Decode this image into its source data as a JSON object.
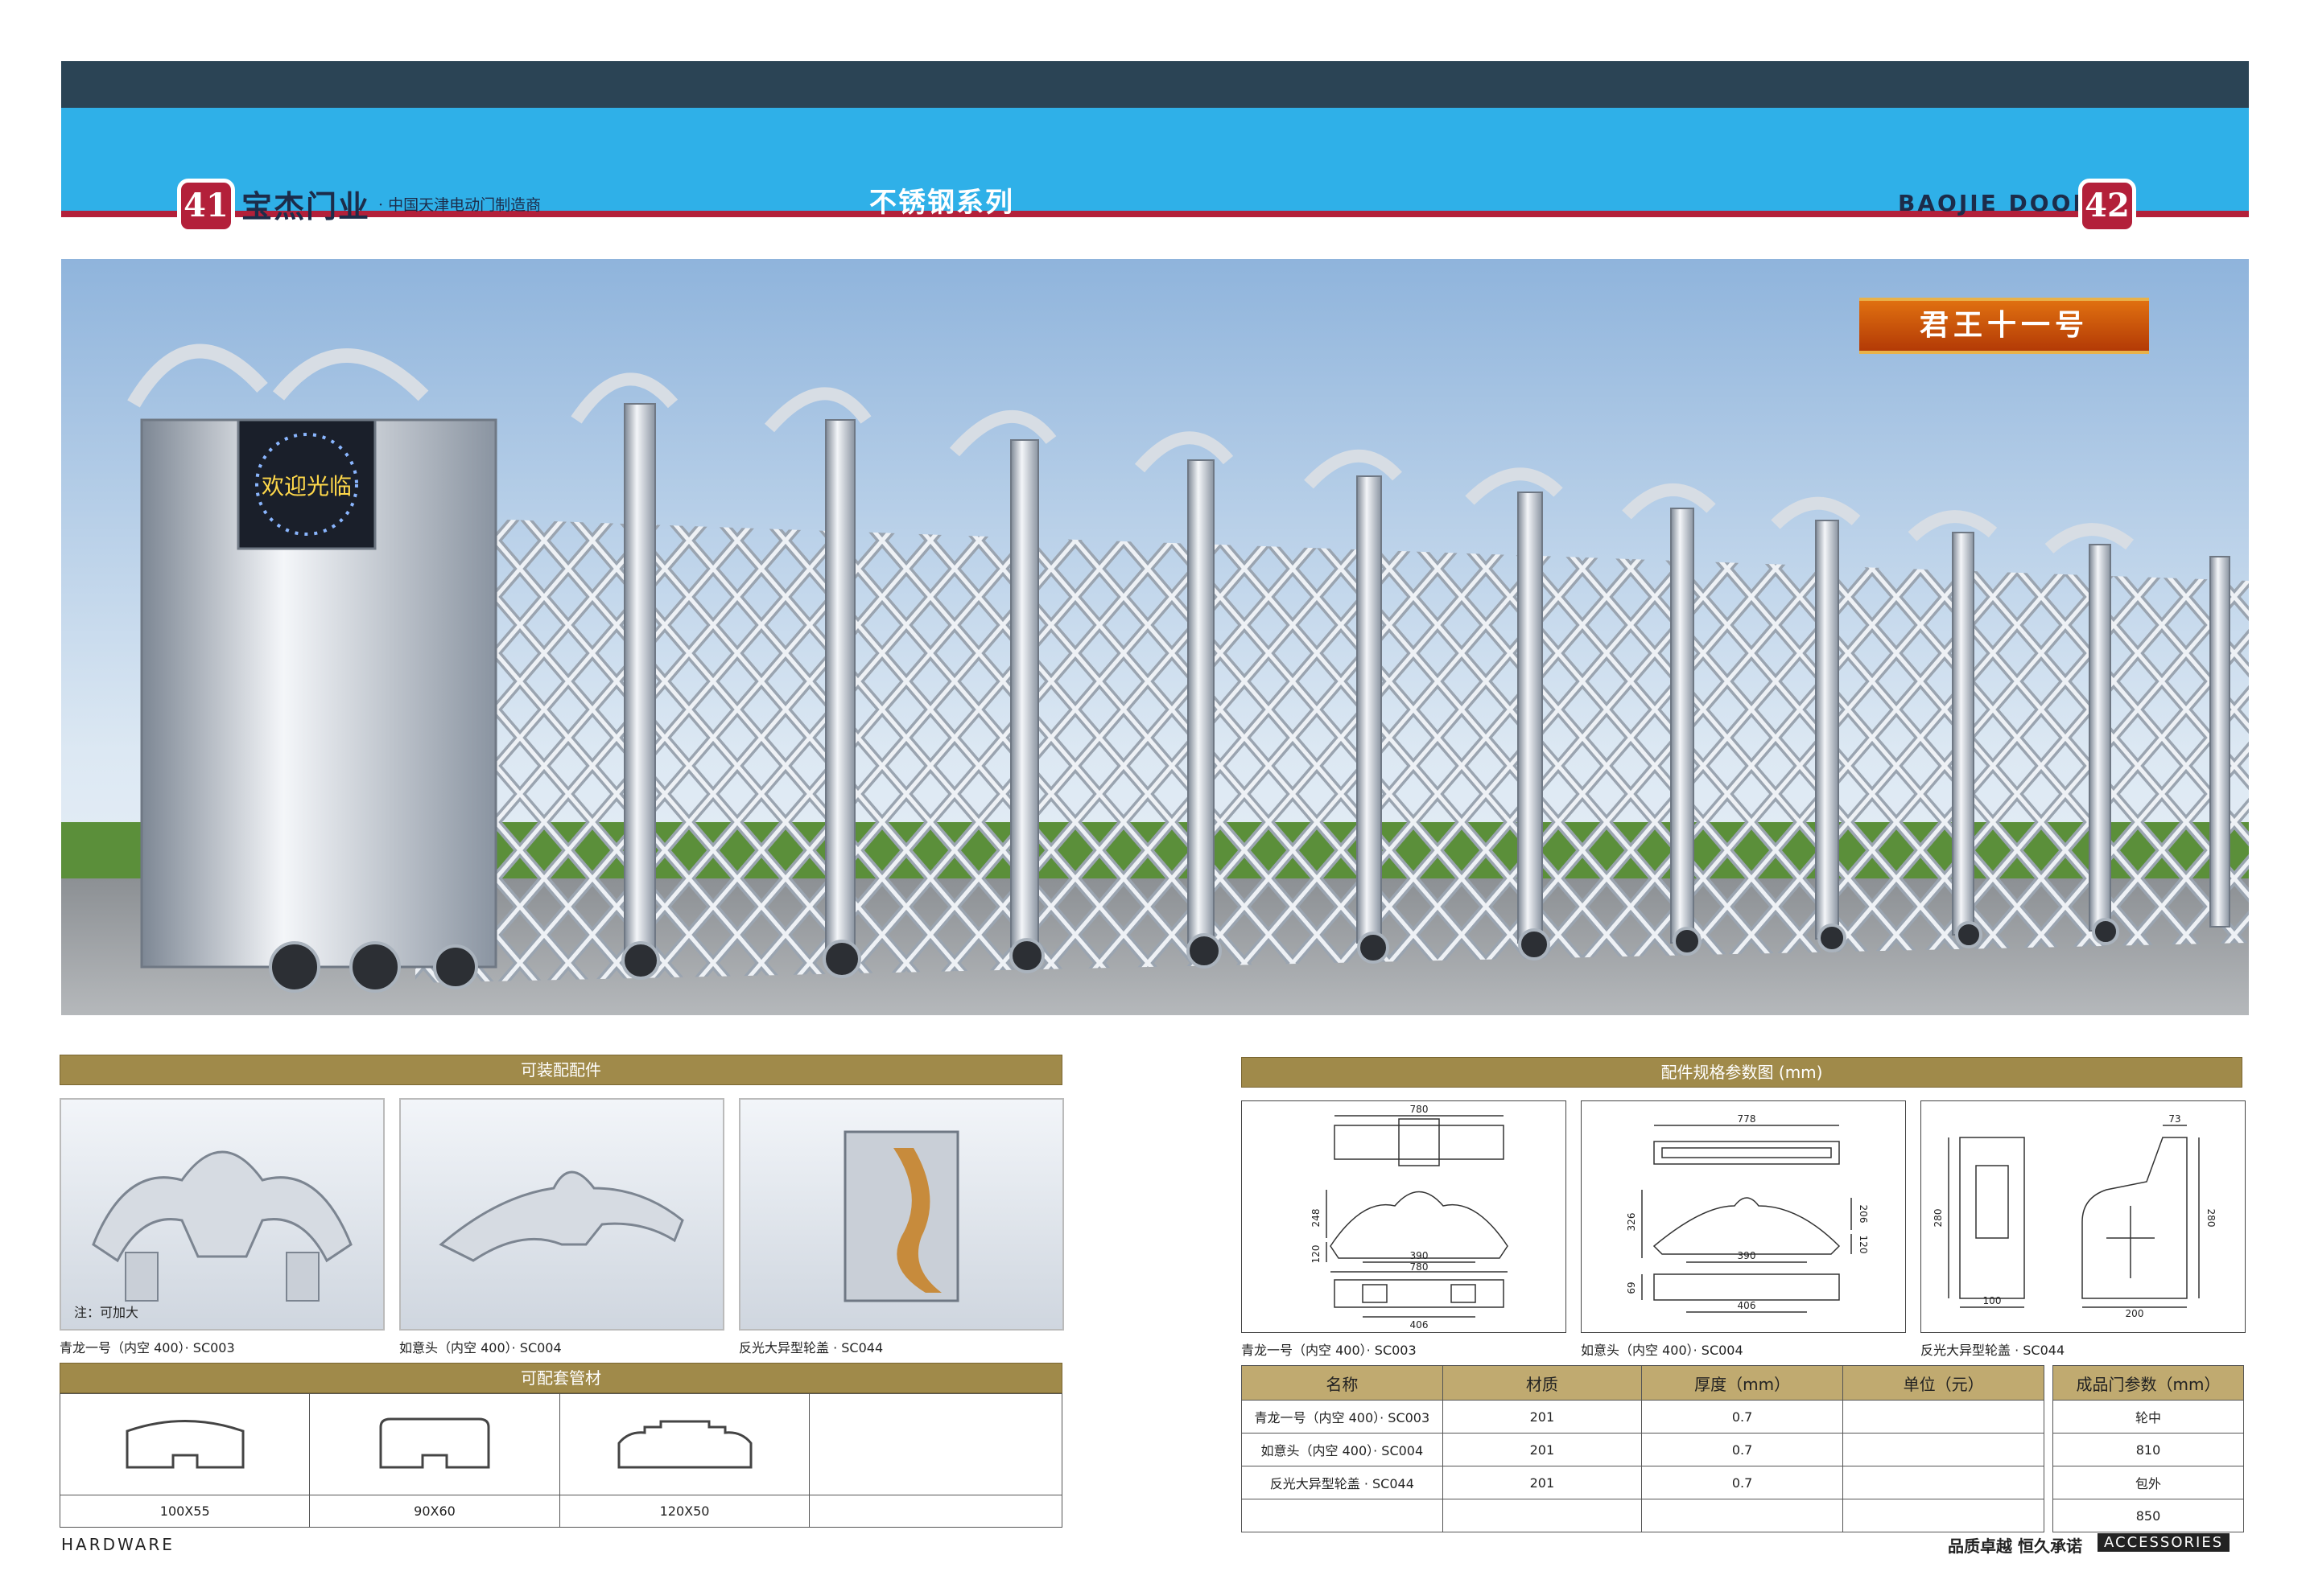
{
  "header": {
    "page_left": "41",
    "page_right": "42",
    "brand_name": "宝杰门业",
    "brand_tagline": "· 中国天津电动门制造商",
    "series_title": "不锈钢系列",
    "brand_en": "BAOJIE DOORS"
  },
  "hero": {
    "product_name": "君王十一号",
    "sign_text": "欢迎光临"
  },
  "accessories": {
    "title": "可装配配件",
    "items": [
      {
        "caption": "青龙一号（内空 400）· SC003",
        "note": "注：可加大"
      },
      {
        "caption": "如意头（内空 400）· SC004"
      },
      {
        "caption": "反光大异型轮盖 · SC044"
      }
    ]
  },
  "profiles": {
    "title": "可配套管材",
    "items": [
      "100X55",
      "90X60",
      "120X50",
      ""
    ]
  },
  "drawings": {
    "title": "配件规格参数图 (mm)",
    "items": [
      {
        "caption": "青龙一号（内空 400）· SC003",
        "dims": [
          "780",
          "248",
          "120",
          "390",
          "780",
          "406"
        ]
      },
      {
        "caption": "如意头（内空 400）· SC004",
        "dims": [
          "778",
          "326",
          "206",
          "120",
          "390",
          "69",
          "406"
        ]
      },
      {
        "caption": "反光大异型轮盖 · SC044",
        "dims": [
          "73",
          "280",
          "280",
          "100",
          "200"
        ]
      }
    ]
  },
  "spec_table": {
    "headers": [
      "名称",
      "材质",
      "厚度（mm）",
      "单位（元）"
    ],
    "rows": [
      [
        "青龙一号（内空 400）· SC003",
        "201",
        "0.7",
        ""
      ],
      [
        "如意头（内空 400）· SC004",
        "201",
        "0.7",
        ""
      ],
      [
        "反光大异型轮盖 · SC044",
        "201",
        "0.7",
        ""
      ],
      [
        "",
        "",
        "",
        ""
      ]
    ]
  },
  "params_table": {
    "header": "成品门参数（mm）",
    "rows": [
      "轮中",
      "810",
      "包外",
      "850"
    ]
  },
  "footer": {
    "left": "HARDWARE",
    "slogan": "品质卓越  恒久承诺",
    "badge": "ACCESSORIES"
  }
}
